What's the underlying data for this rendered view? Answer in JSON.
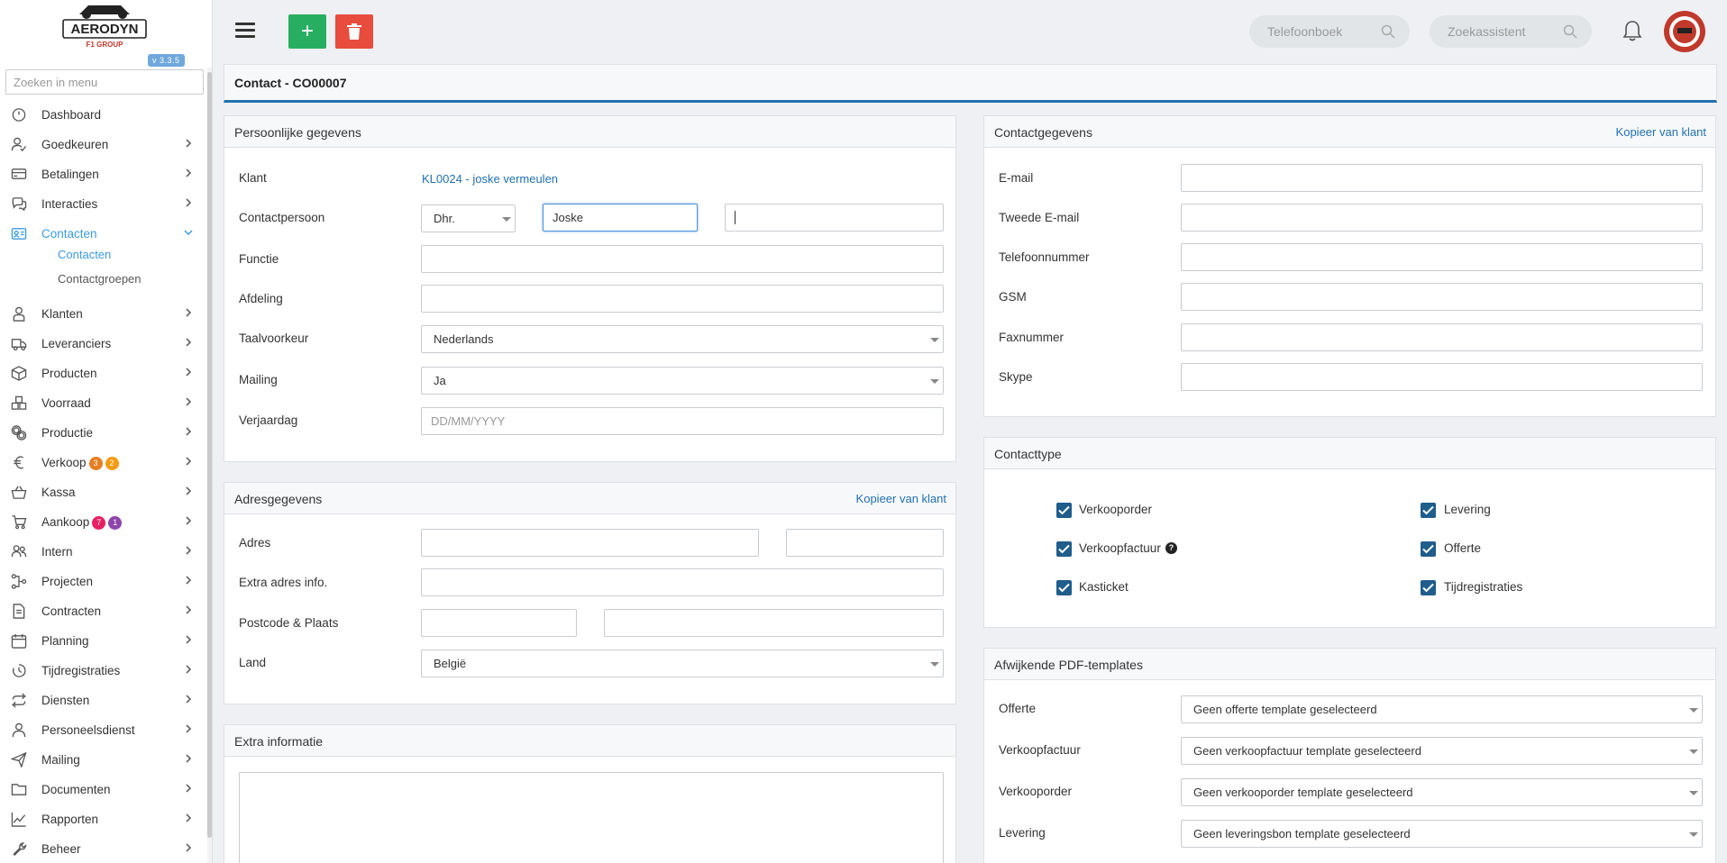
{
  "app": {
    "version": "v 3.3.5",
    "logo_text": "AERODYN",
    "logo_subtext": "F1 GROUP"
  },
  "sidebar": {
    "search_placeholder": "Zoeken in menu",
    "items": [
      {
        "label": "Dashboard",
        "icon": "dashboard-icon"
      },
      {
        "label": "Goedkeuren",
        "icon": "user-check-icon"
      },
      {
        "label": "Betalingen",
        "icon": "credit-card-icon"
      },
      {
        "label": "Interacties",
        "icon": "chat-icon"
      },
      {
        "label": "Contacten",
        "icon": "id-card-icon",
        "active": true
      },
      {
        "label": "Klanten",
        "icon": "customer-icon"
      },
      {
        "label": "Leveranciers",
        "icon": "truck-icon"
      },
      {
        "label": "Producten",
        "icon": "box-icon"
      },
      {
        "label": "Voorraad",
        "icon": "boxes-icon"
      },
      {
        "label": "Productie",
        "icon": "gears-icon"
      },
      {
        "label": "Verkoop",
        "icon": "euro-icon",
        "badges": [
          "3",
          "2"
        ]
      },
      {
        "label": "Kassa",
        "icon": "basket-icon"
      },
      {
        "label": "Aankoop",
        "icon": "cart-icon",
        "badges": [
          "7",
          "1"
        ]
      },
      {
        "label": "Intern",
        "icon": "users-icon"
      },
      {
        "label": "Projecten",
        "icon": "project-icon"
      },
      {
        "label": "Contracten",
        "icon": "contract-icon"
      },
      {
        "label": "Planning",
        "icon": "calendar-icon"
      },
      {
        "label": "Tijdregistraties",
        "icon": "clock-icon"
      },
      {
        "label": "Diensten",
        "icon": "repeat-icon"
      },
      {
        "label": "Personeelsdienst",
        "icon": "person-icon"
      },
      {
        "label": "Mailing",
        "icon": "send-icon"
      },
      {
        "label": "Documenten",
        "icon": "folder-icon"
      },
      {
        "label": "Rapporten",
        "icon": "chart-line-icon"
      },
      {
        "label": "Beheer",
        "icon": "wrench-icon"
      }
    ],
    "sub_items": [
      {
        "label": "Contacten",
        "active": true
      },
      {
        "label": "Contactgroepen",
        "active": false
      }
    ],
    "badge_colors": [
      "#e67e22",
      "#f39c12",
      "#e91e63",
      "#8e44ad"
    ]
  },
  "topbar": {
    "add_label": "+",
    "phonebook_placeholder": "Telefoonboek",
    "search_assistant_placeholder": "Zoekassistent"
  },
  "page": {
    "title": "Contact - CO00007"
  },
  "personal": {
    "title": "Persoonlijke gegevens",
    "klant_label": "Klant",
    "klant_value": "KL0024 - joske vermeulen",
    "contactpersoon_label": "Contactpersoon",
    "salutation": "Dhr.",
    "firstname": "Joske",
    "lastname": "",
    "functie_label": "Functie",
    "afdeling_label": "Afdeling",
    "taal_label": "Taalvoorkeur",
    "taal_value": "Nederlands",
    "mailing_label": "Mailing",
    "mailing_value": "Ja",
    "verjaardag_label": "Verjaardag",
    "verjaardag_placeholder": "DD/MM/YYYY"
  },
  "address": {
    "title": "Adresgegevens",
    "copy_link": "Kopieer van klant",
    "adres_label": "Adres",
    "extra_label": "Extra adres info.",
    "postcode_label": "Postcode & Plaats",
    "land_label": "Land",
    "land_value": "België"
  },
  "extra": {
    "title": "Extra informatie"
  },
  "contact": {
    "title": "Contactgegevens",
    "copy_link": "Kopieer van klant",
    "fields": [
      "E-mail",
      "Tweede E-mail",
      "Telefoonnummer",
      "GSM",
      "Faxnummer",
      "Skype"
    ]
  },
  "contacttype": {
    "title": "Contacttype",
    "items": [
      {
        "label": "Verkooporder",
        "checked": true
      },
      {
        "label": "Levering",
        "checked": true
      },
      {
        "label": "Verkoopfactuur",
        "checked": true,
        "help": true
      },
      {
        "label": "Offerte",
        "checked": true
      },
      {
        "label": "Kasticket",
        "checked": true
      },
      {
        "label": "Tijdregistraties",
        "checked": true
      }
    ]
  },
  "pdf": {
    "title": "Afwijkende PDF-templates",
    "rows": [
      {
        "label": "Offerte",
        "value": "Geen offerte template geselecteerd"
      },
      {
        "label": "Verkoopfactuur",
        "value": "Geen verkoopfactuur template geselecteerd"
      },
      {
        "label": "Verkooporder",
        "value": "Geen verkooporder template geselecteerd"
      },
      {
        "label": "Levering",
        "value": "Geen leveringsbon template geselecteerd"
      }
    ]
  },
  "colors": {
    "accent": "#2271b1",
    "active_nav": "#3b9be0",
    "add_button": "#27ae60",
    "delete_button": "#e74c3c",
    "checkbox": "#1f5d8b"
  }
}
